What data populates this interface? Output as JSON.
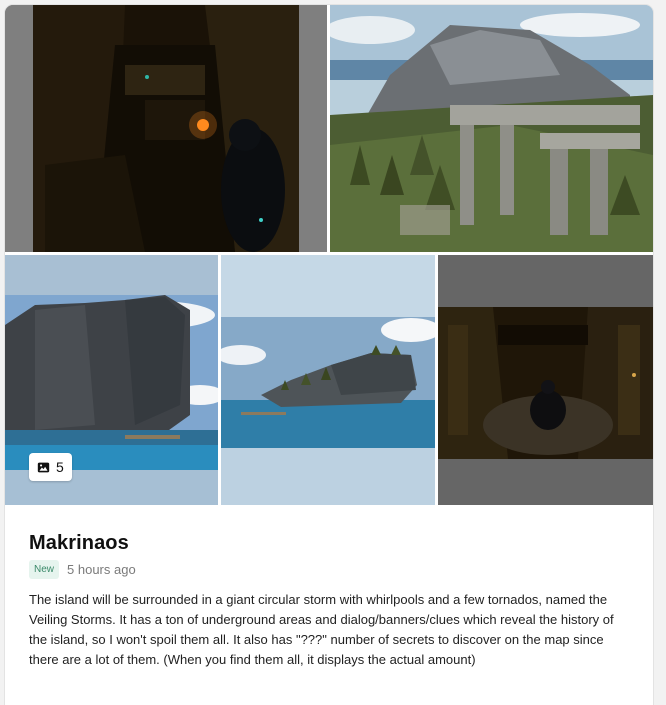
{
  "gallery": {
    "image_count": "5",
    "images": [
      {
        "icon": "dark-corridor-torch"
      },
      {
        "icon": "island-ruins-overview"
      },
      {
        "icon": "cliff-from-sea"
      },
      {
        "icon": "floating-island"
      },
      {
        "icon": "dark-chamber-figure"
      }
    ]
  },
  "post": {
    "title": "Makrinaos",
    "badge": "New",
    "time": "5 hours ago",
    "description": "The island will be surrounded in a giant circular storm with whirlpools and a few tornados, named the Veiling Storms. It has a ton of underground areas and dialog/banners/clues which reveal the history of the island, so I won't spoil them all. It also has \"???\" number of secrets to discover on the map since there are a lot of them. (When you find them all, it displays the actual amount)"
  },
  "colors": {
    "badge_bg": "#e6f4ee",
    "badge_text": "#3b8a6a"
  }
}
